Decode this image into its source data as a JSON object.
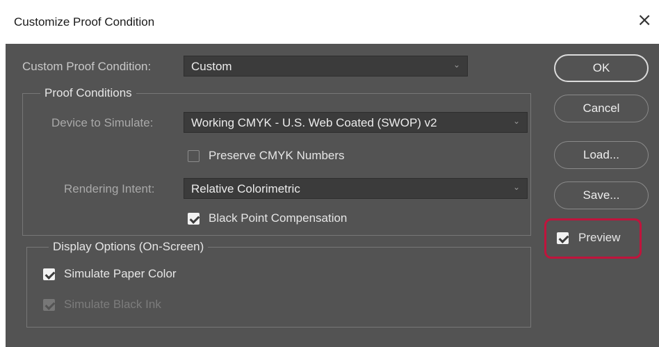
{
  "window": {
    "title": "Customize Proof Condition",
    "close_glyph": "×"
  },
  "custom_proof": {
    "label": "Custom Proof Condition:",
    "value": "Custom"
  },
  "proof_conditions": {
    "title": "Proof Conditions",
    "device_label": "Device to Simulate:",
    "device_value": "Working CMYK - U.S. Web Coated (SWOP) v2",
    "preserve_cmyk": {
      "label": "Preserve CMYK Numbers",
      "checked": false
    },
    "rendering_label": "Rendering Intent:",
    "rendering_value": "Relative Colorimetric",
    "black_point": {
      "label": "Black Point Compensation",
      "checked": true
    }
  },
  "display_options": {
    "title": "Display Options (On-Screen)",
    "paper_color": {
      "label": "Simulate Paper Color",
      "checked": true
    },
    "black_ink": {
      "label": "Simulate Black Ink",
      "checked": true,
      "disabled": true
    }
  },
  "buttons": {
    "ok": "OK",
    "cancel": "Cancel",
    "load": "Load...",
    "save": "Save..."
  },
  "preview": {
    "label": "Preview",
    "checked": true
  },
  "icons": {
    "dropdown": "chevron-down-icon",
    "close": "close-icon"
  },
  "colors": {
    "dialog_bg": "#535353",
    "field_bg": "#3b3b3b",
    "highlight": "#c0143c"
  }
}
